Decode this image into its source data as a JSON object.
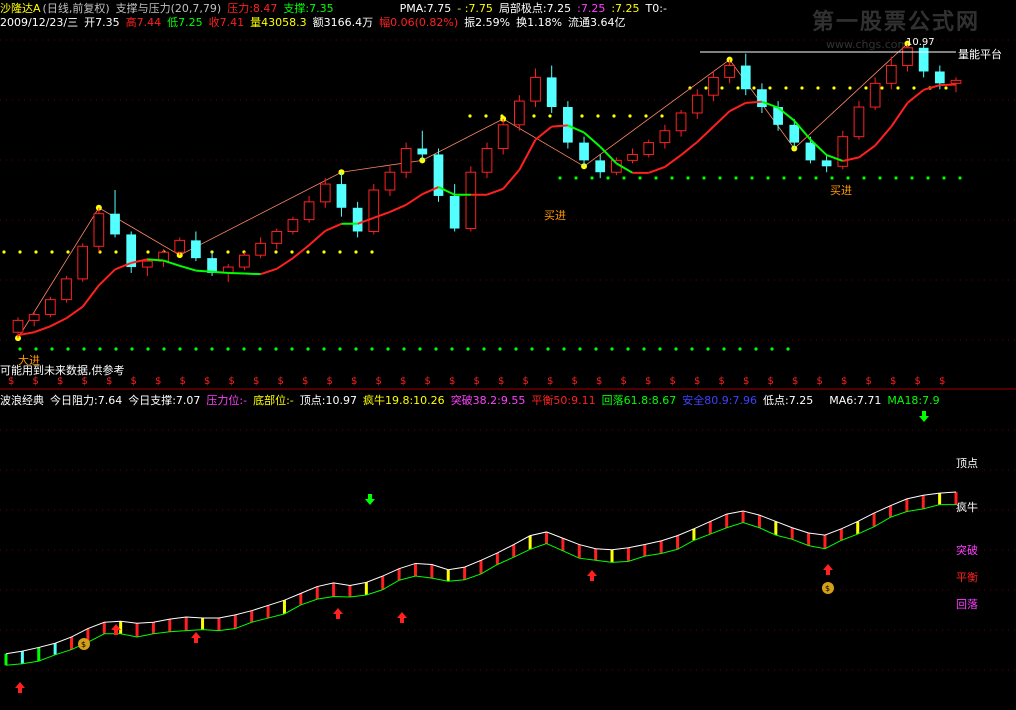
{
  "header1": {
    "name": "沙隆达A",
    "period": "(日线,前复权)",
    "indicator": "支撑与压力(20,7,79)",
    "pressure": "压力:8.47",
    "support": "支撑:7.35",
    "pma": "PMA:7.75",
    "dash1": "- :7.75",
    "local_extreme": "局部极点:7.25",
    "v2": ":7.25",
    "v3": ":7.25",
    "t0": "T0:-"
  },
  "header2": {
    "date": "2009/12/23/三",
    "open": "开7.35",
    "high": "高7.44",
    "low": "低7.25",
    "close": "收7.41",
    "volume": "量43058.3",
    "amount": "额3166.4万",
    "change": "幅0.06(0.82%)",
    "amplitude": "振2.59%",
    "turnover": "换1.18%",
    "float": "流通3.64亿"
  },
  "notes": {
    "future": "可能用到未来数据,供参考",
    "buy": "买进",
    "level_label": "量能平台",
    "peak_value": "10.97",
    "left_tag": "大进"
  },
  "header3": {
    "name": "波浪经典",
    "resist": "今日阻力:7.64",
    "support": "今日支撑:7.07",
    "pressure_pos": "压力位:-",
    "bottom_pos": "底部位:-",
    "top": "顶点:10.97",
    "crazy": "疯牛19.8:10.26",
    "break": "突破38.2:9.55",
    "balance": "平衡50:9.11",
    "fall": "回落61.8:8.67",
    "safe": "安全80.9:7.96",
    "low": "低点:7.25",
    "ma6": "MA6:7.71",
    "ma18": "MA18:7.9"
  },
  "sub_labels": {
    "top": "顶点",
    "crazy": "疯牛",
    "break": "突破",
    "balance": "平衡",
    "fall": "回落"
  },
  "watermark": {
    "title": "第一股票公式网",
    "url": "www.chgs.com"
  },
  "colors": {
    "up": "#ff2020",
    "down": "#54ffff",
    "yellow": "#ffff00",
    "green": "#00ff00",
    "white": "#ffffff",
    "magenta": "#ff40ff",
    "blue": "#0000ff"
  },
  "chart_data": [
    {
      "type": "candlestick",
      "title": "",
      "series_labels": [
        "K线",
        "支撑与压力线"
      ],
      "candles": [
        [
          6.1,
          6.35,
          6.0,
          6.3
        ],
        [
          6.3,
          6.45,
          6.2,
          6.4
        ],
        [
          6.4,
          6.7,
          6.35,
          6.65
        ],
        [
          6.65,
          7.05,
          6.6,
          7.0
        ],
        [
          7.0,
          7.6,
          6.95,
          7.55
        ],
        [
          7.55,
          8.2,
          7.45,
          8.1
        ],
        [
          8.1,
          8.5,
          7.7,
          7.75
        ],
        [
          7.75,
          7.8,
          7.1,
          7.2
        ],
        [
          7.2,
          7.35,
          7.05,
          7.3
        ],
        [
          7.3,
          7.5,
          7.2,
          7.45
        ],
        [
          7.45,
          7.7,
          7.4,
          7.65
        ],
        [
          7.65,
          7.8,
          7.3,
          7.35
        ],
        [
          7.35,
          7.45,
          7.05,
          7.1
        ],
        [
          7.1,
          7.25,
          6.95,
          7.2
        ],
        [
          7.2,
          7.45,
          7.15,
          7.4
        ],
        [
          7.4,
          7.7,
          7.35,
          7.6
        ],
        [
          7.6,
          7.85,
          7.5,
          7.8
        ],
        [
          7.8,
          8.05,
          7.75,
          8.0
        ],
        [
          8.0,
          8.4,
          7.95,
          8.3
        ],
        [
          8.3,
          8.7,
          8.2,
          8.6
        ],
        [
          8.6,
          8.8,
          8.05,
          8.2
        ],
        [
          8.2,
          8.3,
          7.7,
          7.8
        ],
        [
          7.8,
          8.6,
          7.75,
          8.5
        ],
        [
          8.5,
          8.9,
          8.4,
          8.8
        ],
        [
          8.8,
          9.3,
          8.7,
          9.2
        ],
        [
          9.2,
          9.5,
          9.0,
          9.1
        ],
        [
          9.1,
          9.2,
          8.3,
          8.4
        ],
        [
          8.4,
          8.6,
          7.8,
          7.85
        ],
        [
          7.85,
          8.9,
          7.8,
          8.8
        ],
        [
          8.8,
          9.3,
          8.7,
          9.2
        ],
        [
          9.2,
          9.7,
          9.1,
          9.6
        ],
        [
          9.6,
          10.1,
          9.5,
          10.0
        ],
        [
          10.0,
          10.55,
          9.9,
          10.4
        ],
        [
          10.4,
          10.6,
          9.8,
          9.9
        ],
        [
          9.9,
          10.0,
          9.2,
          9.3
        ],
        [
          9.3,
          9.4,
          8.9,
          9.0
        ],
        [
          9.0,
          9.1,
          8.7,
          8.8
        ],
        [
          8.8,
          9.05,
          8.75,
          9.0
        ],
        [
          9.0,
          9.2,
          8.95,
          9.1
        ],
        [
          9.1,
          9.35,
          9.05,
          9.3
        ],
        [
          9.3,
          9.6,
          9.2,
          9.5
        ],
        [
          9.5,
          9.85,
          9.4,
          9.8
        ],
        [
          9.8,
          10.2,
          9.7,
          10.1
        ],
        [
          10.1,
          10.5,
          10.0,
          10.4
        ],
        [
          10.4,
          10.7,
          10.3,
          10.6
        ],
        [
          10.6,
          10.8,
          10.1,
          10.2
        ],
        [
          10.2,
          10.3,
          9.8,
          9.9
        ],
        [
          9.9,
          10.0,
          9.5,
          9.6
        ],
        [
          9.6,
          9.7,
          9.2,
          9.3
        ],
        [
          9.3,
          9.4,
          8.95,
          9.0
        ],
        [
          9.0,
          9.1,
          8.8,
          8.9
        ],
        [
          8.9,
          9.5,
          8.85,
          9.4
        ],
        [
          9.4,
          10.0,
          9.35,
          9.9
        ],
        [
          9.9,
          10.4,
          9.85,
          10.3
        ],
        [
          10.3,
          10.75,
          10.2,
          10.6
        ],
        [
          10.6,
          10.97,
          10.5,
          10.9
        ],
        [
          10.9,
          10.95,
          10.4,
          10.5
        ],
        [
          10.5,
          10.6,
          10.2,
          10.3
        ],
        [
          10.3,
          10.4,
          10.15,
          10.35
        ]
      ],
      "ylim": [
        5.8,
        11.2
      ]
    },
    {
      "type": "bar",
      "title": "",
      "values": [
        7.1,
        7.15,
        7.22,
        7.3,
        7.42,
        7.58,
        7.7,
        7.72,
        7.68,
        7.7,
        7.76,
        7.8,
        7.78,
        7.78,
        7.84,
        7.92,
        8.02,
        8.12,
        8.25,
        8.38,
        8.45,
        8.4,
        8.46,
        8.58,
        8.72,
        8.82,
        8.8,
        8.7,
        8.75,
        8.88,
        9.02,
        9.18,
        9.35,
        9.42,
        9.3,
        9.18,
        9.1,
        9.08,
        9.12,
        9.18,
        9.25,
        9.35,
        9.48,
        9.62,
        9.76,
        9.82,
        9.74,
        9.62,
        9.5,
        9.4,
        9.36,
        9.48,
        9.62,
        9.78,
        9.92,
        10.05,
        10.12,
        10.16,
        10.18
      ],
      "ylim": [
        6.6,
        10.6
      ]
    }
  ]
}
